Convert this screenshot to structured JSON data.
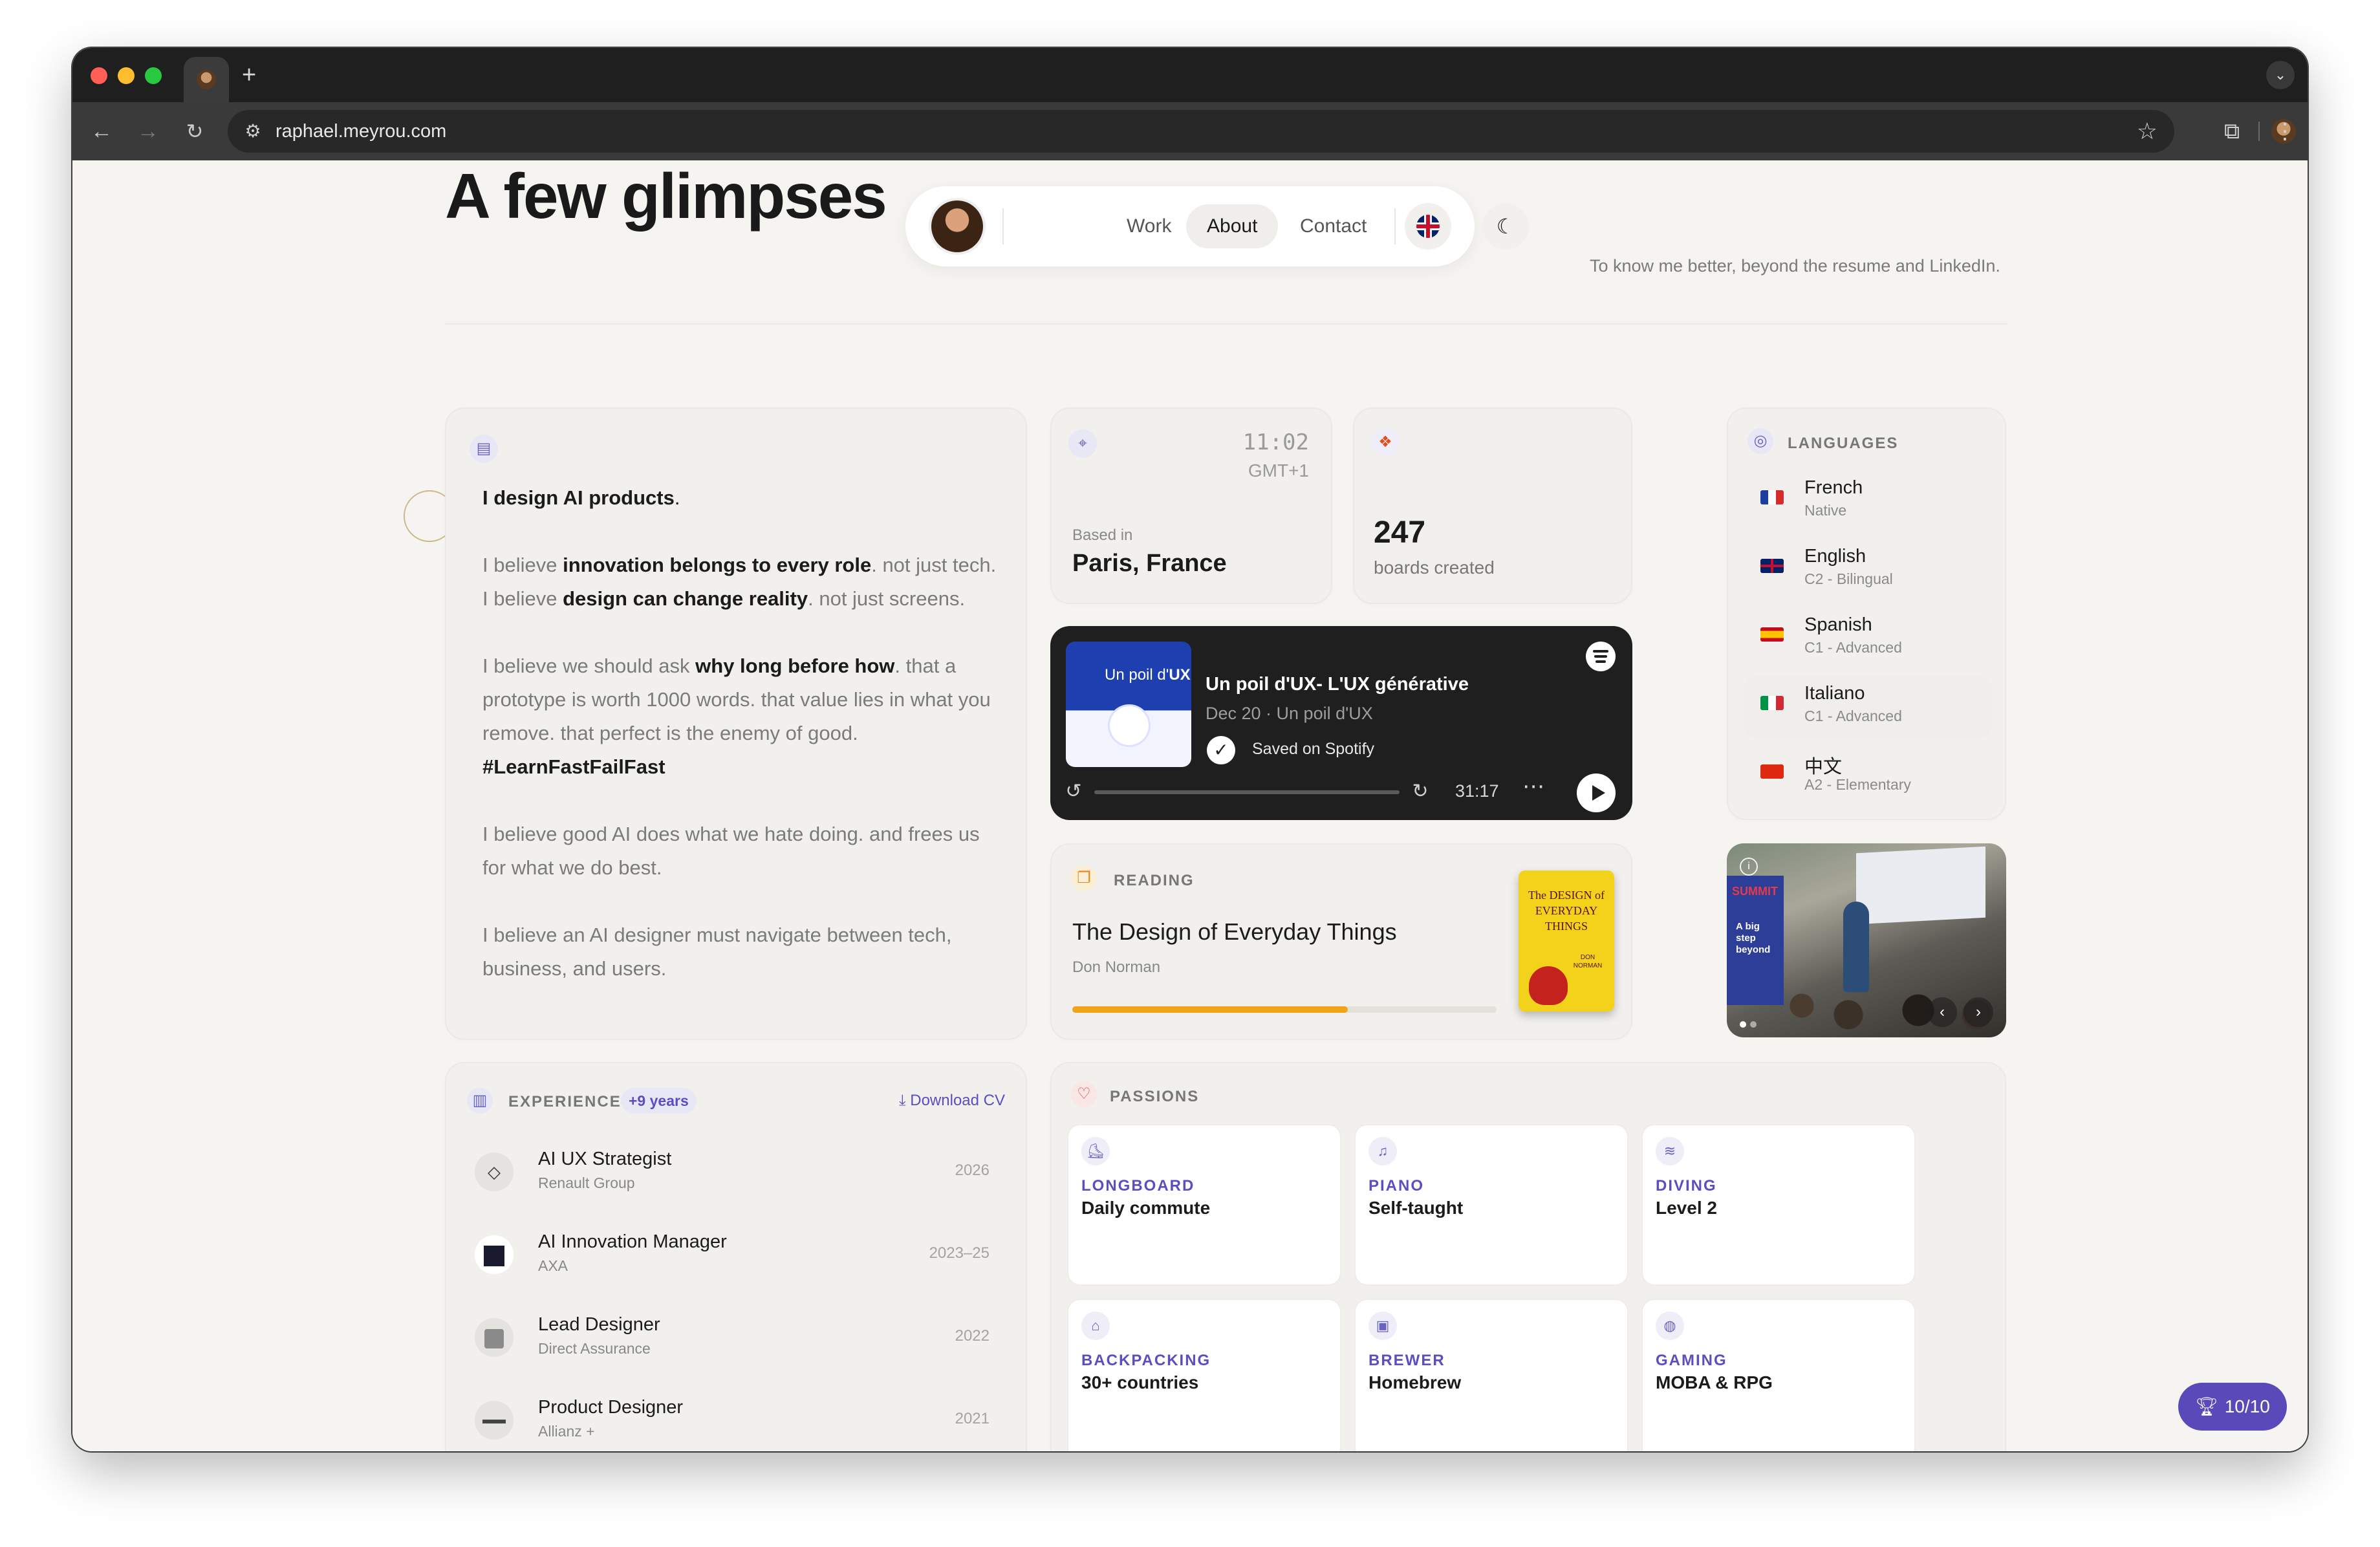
{
  "browser": {
    "new_tab": "+",
    "tab_menu": "⌄",
    "url": "raphael.meyrou.com"
  },
  "hero": {
    "title": "A few glimpses",
    "subtitle": "To know me better, beyond the resume and LinkedIn."
  },
  "nav": {
    "links": [
      "Work",
      "About",
      "Contact"
    ],
    "active": "About"
  },
  "manifesto": {
    "p1": [
      "I design AI products",
      "."
    ],
    "p2": [
      "I believe ",
      "innovation belongs to every role",
      ". not just tech. I believe ",
      "design can change reality",
      ". not just screens."
    ],
    "p3": [
      "I believe we should ask ",
      "why long before how",
      ". that a prototype is worth 1000 words. that value lies in what you remove. that perfect is the enemy of good. ",
      "#LearnFastFailFast"
    ],
    "p4": "I believe good AI does what we hate doing. and frees us for what we do best.",
    "p5": "I believe an AI designer must navigate between tech, business, and users."
  },
  "location": {
    "time": "11:02",
    "tz": "GMT+1",
    "label": "Based in",
    "city": "Paris, France"
  },
  "figma": {
    "count": "247",
    "label": "boards created"
  },
  "spotify": {
    "cover_title_prefix": "Un poil d'",
    "cover_title_bold": "UX",
    "title": "Un poil d'UX- L'UX générative",
    "subtitle": "Dec 20 · Un poil d'UX",
    "saved": "Saved on Spotify",
    "skip_back": "15",
    "skip_fwd": "15",
    "time": "31:17",
    "progress": 0.0
  },
  "languages": {
    "title": "LANGUAGES",
    "items": [
      {
        "name": "French",
        "level": "Native",
        "flag": "fr"
      },
      {
        "name": "English",
        "level": "C2 - Bilingual",
        "flag": "uk"
      },
      {
        "name": "Spanish",
        "level": "C1 - Advanced",
        "flag": "es"
      },
      {
        "name": "Italiano",
        "level": "C1 - Advanced",
        "flag": "it"
      },
      {
        "name": "中文",
        "level": "A2 - Elementary",
        "flag": "cn"
      }
    ]
  },
  "reading": {
    "eyebrow": "READING",
    "title": "The Design of Everyday Things",
    "author": "Don Norman",
    "progress": 0.65,
    "book_title": "The DESIGN of EVERYDAY THINGS",
    "book_author": "DON NORMAN"
  },
  "photo": {
    "banner_head": "SUMMIT",
    "banner_text": "A big step beyond",
    "colors": {
      "accent": "#2c3e97"
    }
  },
  "experience": {
    "title": "EXPERIENCE",
    "badge": "+9 years",
    "download": "Download CV",
    "items": [
      {
        "role": "AI UX Strategist",
        "company": "Renault Group",
        "year": "2026"
      },
      {
        "role": "AI Innovation Manager",
        "company": "AXA",
        "year": "2023–25"
      },
      {
        "role": "Lead Designer",
        "company": "Direct Assurance",
        "year": "2022"
      },
      {
        "role": "Product Designer",
        "company": "Allianz +",
        "year": "2021"
      }
    ]
  },
  "passions": {
    "title": "PASSIONS",
    "items": [
      {
        "label": "LONGBOARD",
        "value": "Daily commute",
        "icon": "skate-icon"
      },
      {
        "label": "PIANO",
        "value": "Self-taught",
        "icon": "music-icon"
      },
      {
        "label": "DIVING",
        "value": "Level 2",
        "icon": "waves-icon"
      },
      {
        "label": "BACKPACKING",
        "value": "30+ countries",
        "icon": "backpack-icon"
      },
      {
        "label": "BREWER",
        "value": "Homebrew",
        "icon": "beer-icon"
      },
      {
        "label": "GAMING",
        "value": "MOBA & RPG",
        "icon": "gamepad-icon"
      }
    ]
  },
  "trophy": {
    "score": "10/10"
  },
  "colors": {
    "accent": "#5b4fc0",
    "spotify_bg": "#1f1f1f",
    "reading_bar": "#f0a418"
  }
}
